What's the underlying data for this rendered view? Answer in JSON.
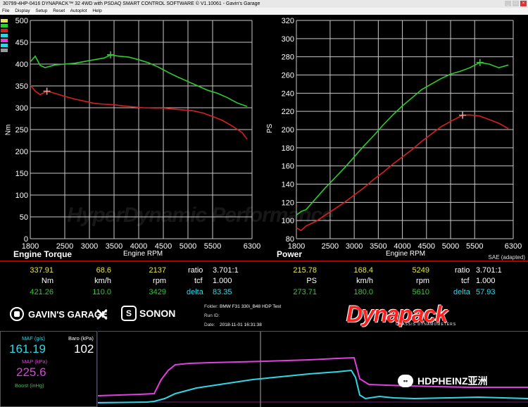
{
  "window": {
    "title": "30799-4HP-0416 DYNAPACK™ 32 4WD with PSDAQ SMART CONTROL SOFTWARE © V1.10061 - Gavin's Garage",
    "menu": [
      "File",
      "Display",
      "Setup",
      "Reset",
      "Autoplot",
      "Help"
    ]
  },
  "colors": {
    "green": "#2ecc2e",
    "red": "#d62020",
    "yellow": "#e6e64a",
    "cyan": "#2fd7e6",
    "magenta": "#e040e0",
    "grid": "#c8c8c8"
  },
  "chart_data": [
    {
      "type": "line",
      "title": "Engine Torque",
      "xlabel": "Engine RPM",
      "ylabel": "Nm",
      "xlim": [
        1800,
        6300
      ],
      "ylim": [
        0,
        500
      ],
      "xticks": [
        1800,
        2500,
        3000,
        3500,
        4000,
        4500,
        5000,
        5500,
        6300
      ],
      "yticks": [
        0,
        50,
        100,
        150,
        200,
        250,
        300,
        350,
        400,
        450,
        500
      ],
      "grid": true,
      "series": [
        {
          "color": "#2ecc2e",
          "x": [
            1800,
            1900,
            2000,
            2100,
            2300,
            2500,
            2700,
            2900,
            3100,
            3300,
            3430,
            3600,
            3800,
            4000,
            4200,
            4400,
            4600,
            4800,
            5000,
            5200,
            5400,
            5600,
            5800,
            6000,
            6200
          ],
          "values": [
            405,
            418,
            397,
            392,
            398,
            400,
            402,
            406,
            410,
            414,
            421,
            418,
            416,
            410,
            403,
            393,
            381,
            370,
            360,
            350,
            340,
            333,
            323,
            311,
            303
          ],
          "marker": [
            3429,
            421.26
          ]
        },
        {
          "color": "#d62020",
          "x": [
            1800,
            1900,
            2000,
            2137,
            2300,
            2500,
            2700,
            2900,
            3100,
            3300,
            3500,
            3700,
            3900,
            4100,
            4300,
            4500,
            4700,
            4900,
            5100,
            5300,
            5500,
            5700,
            5900,
            6100,
            6200
          ],
          "values": [
            352,
            338,
            330,
            338,
            333,
            326,
            320,
            315,
            310,
            308,
            307,
            304,
            302,
            300,
            299,
            299,
            297,
            295,
            293,
            288,
            280,
            271,
            258,
            243,
            228
          ],
          "marker": [
            2137,
            337.91
          ]
        }
      ]
    },
    {
      "type": "line",
      "title": "Power",
      "xlabel": "Engine RPM",
      "ylabel": "PS",
      "xlim": [
        1800,
        6300
      ],
      "ylim": [
        80,
        320
      ],
      "xticks": [
        1800,
        2500,
        3000,
        3500,
        4000,
        4500,
        5000,
        5500,
        6300
      ],
      "yticks": [
        80,
        100,
        120,
        140,
        160,
        180,
        200,
        220,
        240,
        260,
        280,
        300,
        320
      ],
      "grid": true,
      "series": [
        {
          "color": "#2ecc2e",
          "x": [
            1800,
            1900,
            2000,
            2200,
            2400,
            2600,
            2800,
            3000,
            3200,
            3400,
            3600,
            3800,
            4000,
            4200,
            4400,
            4600,
            4800,
            5000,
            5200,
            5400,
            5610,
            5800,
            6000,
            6200
          ],
          "values": [
            106,
            110,
            112,
            124,
            136,
            147,
            158,
            170,
            182,
            193,
            205,
            216,
            226,
            235,
            244,
            250,
            256,
            261,
            264,
            268,
            273.7,
            272,
            268,
            271
          ],
          "marker": [
            5610,
            273.71
          ]
        },
        {
          "color": "#d62020",
          "x": [
            1800,
            1900,
            2000,
            2200,
            2400,
            2600,
            2800,
            3000,
            3200,
            3400,
            3600,
            3800,
            4000,
            4200,
            4400,
            4600,
            4800,
            5000,
            5249,
            5400,
            5600,
            5800,
            6000,
            6200
          ],
          "values": [
            92,
            89,
            94,
            99,
            106,
            113,
            120,
            128,
            136,
            145,
            153,
            162,
            170,
            178,
            187,
            195,
            203,
            209,
            215.8,
            216,
            215,
            211,
            207,
            201
          ],
          "marker": [
            5249,
            215.78
          ]
        }
      ]
    }
  ],
  "axis_labels": {
    "torque_title": "Engine Torque",
    "torque_x": "Engine RPM",
    "torque_y": "Nm",
    "power_title": "Power",
    "power_x": "Engine RPM",
    "power_y": "PS",
    "sae": "SAE (adapted)"
  },
  "readouts": {
    "left": {
      "row1": {
        "a": "337.91",
        "b": "68.6",
        "c": "2137",
        "label1": "ratio",
        "val1": "3.701:1"
      },
      "units": {
        "a": "Nm",
        "b": "km/h",
        "c": "rpm",
        "label1": "tcf",
        "val1": "1.000"
      },
      "row3": {
        "a": "421.26",
        "b": "110.0",
        "c": "3429",
        "label1": "delta",
        "val1": "83.35"
      }
    },
    "right": {
      "row1": {
        "a": "215.78",
        "b": "168.4",
        "c": "5249",
        "label1": "ratio",
        "val1": "3.701:1"
      },
      "units": {
        "a": "PS",
        "b": "km/h",
        "c": "rpm",
        "label1": "tcf",
        "val1": "1.000"
      },
      "row3": {
        "a": "273.71",
        "b": "180.0",
        "c": "5610",
        "label1": "delta",
        "val1": "57.93"
      }
    }
  },
  "logos": {
    "garage": "GAVIN'S GARAGE",
    "sonon": "SONON",
    "dynapack": "Dynapack",
    "dynapack_sub": "CHASSIS DYNAMOMETERS"
  },
  "run_info": {
    "folder_label": "Folder:",
    "folder": "BMW F31 330i_B48 HDP Test",
    "runid_label": "Run ID:",
    "runid": "",
    "date_label": "Date:",
    "date": "2018-11-01 16:31:38"
  },
  "live": {
    "maf_label": "MAF (g/s)",
    "maf": "161.19",
    "baro_label": "Baro (kPa)",
    "baro": "102",
    "map_label": "MAP (kPa)",
    "map": "225.6",
    "boost_label": "Boost (inHg)"
  },
  "watermark": {
    "brand": "HDPHEINZ亚洲",
    "bg_text": "HyperDynamic Performance"
  }
}
